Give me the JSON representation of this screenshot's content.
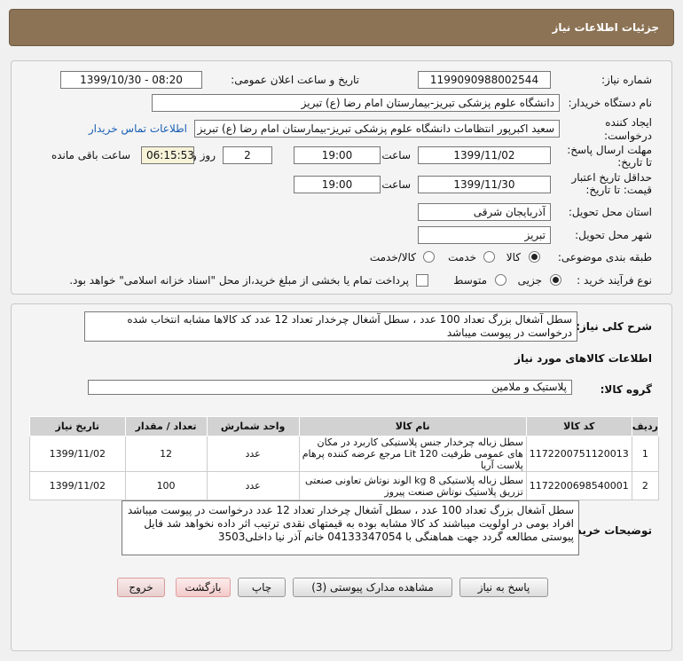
{
  "header": {
    "title": "جزئیات اطلاعات نیاز"
  },
  "details": {
    "need_number_label": "شماره نیاز:",
    "need_number": "1199090988002544",
    "announce_label": "تاریخ و ساعت اعلان عمومی:",
    "announce_value": "1399/10/30 - 08:20",
    "buyer_org_label": "نام دستگاه خریدار:",
    "buyer_org": "دانشگاه علوم پزشکی تبریز-بیمارستان امام رضا (ع) تبریز",
    "creator_label": "ایجاد کننده درخواست:",
    "creator": "سعید اکبرپور انتظامات دانشگاه علوم پزشکی تبریز-بیمارستان امام رضا (ع) تبریز",
    "contact_link": "اطلاعات تماس خریدار",
    "reply_deadline_label": "مهلت ارسال پاسخ: تا تاریخ:",
    "reply_date": "1399/11/02",
    "time_label": "ساعت",
    "reply_time": "19:00",
    "days_value": "2",
    "days_label": "روز و",
    "remaining_time": "06:15:53",
    "remaining_label": "ساعت باقی مانده",
    "validity_label": "حداقل تاریخ اعتبار قیمت: تا تاریخ:",
    "validity_date": "1399/11/30",
    "validity_time": "19:00",
    "province_label": "استان محل تحویل:",
    "province": "آذربایجان شرقی",
    "city_label": "شهر محل تحویل:",
    "city": "تبریز",
    "category_label": "طبقه بندی موضوعی:",
    "category_options": [
      "کالا",
      "خدمت",
      "کالا/خدمت"
    ],
    "process_label": "نوع فرآیند خرید :",
    "process_options": [
      "جزیی",
      "متوسط"
    ],
    "payment_note": "پرداخت تمام یا بخشی از مبلغ خرید،از محل \"اسناد خزانه اسلامی\" خواهد بود."
  },
  "summary": {
    "label": "شرح کلی نیاز:",
    "text": "سطل آشغال بزرگ تعداد 100 عدد ، سطل آشغال چرخدار تعداد 12 عدد کد کالاها مشابه انتخاب شده درخواست در پیوست میباشد"
  },
  "goods_section_title": "اطلاعات کالاهای مورد نیاز",
  "goods_group": {
    "label": "گروه کالا:",
    "value": "پلاستیک و ملامین"
  },
  "table": {
    "headers": [
      "ردیف",
      "کد کالا",
      "نام کالا",
      "واحد شمارش",
      "تعداد / مقدار",
      "تاریخ نیاز"
    ],
    "rows": [
      {
        "idx": "1",
        "code": "1172200751120013",
        "name": "سطل زباله چرخدار جنس پلاستیکی کاربرد در مکان های عمومی ظرفیت 120 Lit مرجع عرضه کننده پرهام پلاست آریا",
        "unit": "عدد",
        "qty": "12",
        "date": "1399/11/02"
      },
      {
        "idx": "2",
        "code": "1172200698540001",
        "name": "سطل زباله پلاستیکی 8 kg الوند نوتاش تعاونی صنعتی تزریق پلاستیک نوتاش صنعت پیروز",
        "unit": "عدد",
        "qty": "100",
        "date": "1399/11/02"
      }
    ]
  },
  "buyer_notes": {
    "label": "توضیحات خریدار:",
    "text": "سطل آشغال بزرگ تعداد 100 عدد ، سطل آشغال چرخدار تعداد 12 عدد درخواست در پیوست میباشد افراد بومی در اولویت میباشند کد کالا مشابه بوده به قیمتهای نقدی ترتیب اثر داده نخواهد شد فایل پیوستی مطالعه گردد جهت هماهنگی با 04133347054 خانم آذر نیا داخلی3503"
  },
  "buttons": {
    "reply": "پاسخ به نیاز",
    "attachments": "مشاهده مدارک پیوستی (3)",
    "print": "چاپ",
    "back": "بازگشت",
    "exit": "خروج"
  }
}
